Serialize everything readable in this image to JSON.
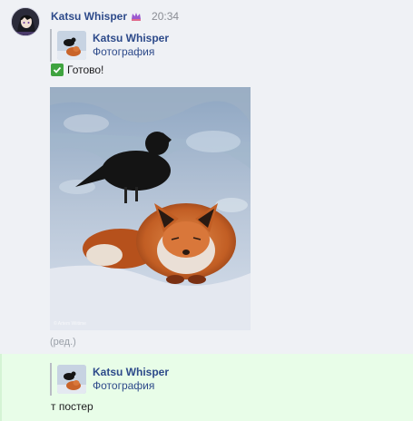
{
  "message_1": {
    "author": "Katsu Whisper",
    "time": "20:34",
    "badge_icon": "purple-crown-icon",
    "reply": {
      "author": "Katsu Whisper",
      "subtitle": "Фотография",
      "thumb_icon": "crow-fox-thumbnail"
    },
    "text": "Готово!",
    "check_icon": "green-checkmark-icon",
    "photo_caption": "© Artem Wiitime",
    "edited_label": "(ред.)"
  },
  "message_2": {
    "reply": {
      "author": "Katsu Whisper",
      "subtitle": "Фотография",
      "thumb_icon": "crow-fox-thumbnail"
    },
    "text": "т постер"
  },
  "colors": {
    "author": "#2d4a8a",
    "highlight_bg": "#e8fde8",
    "page_bg": "#eff1f5",
    "check_green": "#3fa33f"
  }
}
